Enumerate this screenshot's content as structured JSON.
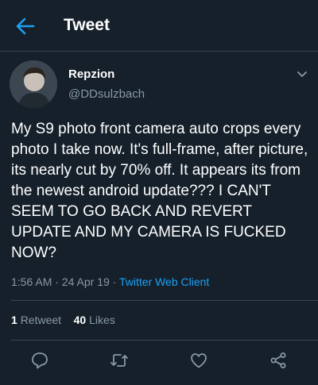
{
  "header": {
    "title": "Tweet",
    "back_icon": "back-arrow-icon"
  },
  "tweet": {
    "author_name": "Repzion",
    "author_handle": "@DDsulzbach",
    "text": "My S9 photo front camera auto crops every photo I take now. It's full-frame, after picture, its nearly cut by 70% off. It appears its from the newest android update??? I CAN'T SEEM TO GO BACK AND REVERT UPDATE AND MY CAMERA IS FUCKED NOW?",
    "time": "1:56 AM",
    "date": "24 Apr 19",
    "separator": "·",
    "client": "Twitter Web Client"
  },
  "stats": {
    "retweets_count": "1",
    "retweets_label": "Retweet",
    "likes_count": "40",
    "likes_label": "Likes"
  },
  "actions": [
    "reply-icon",
    "retweet-icon",
    "like-icon",
    "share-icon"
  ],
  "colors": {
    "background": "#15202b",
    "accent": "#1da1f2",
    "secondary_text": "#8899a6",
    "divider": "#38444d"
  }
}
